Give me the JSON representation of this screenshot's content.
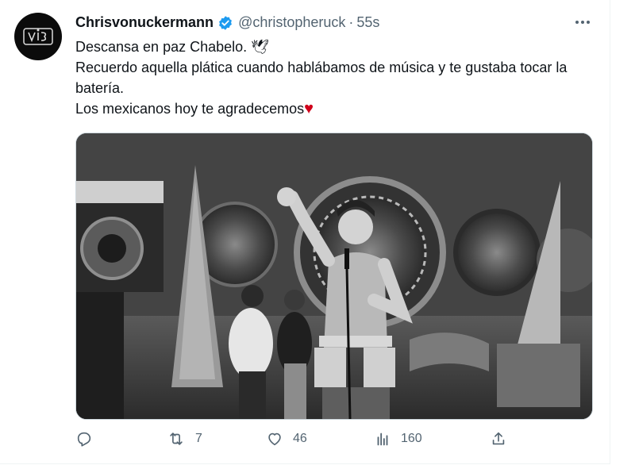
{
  "author": {
    "display_name": "Chrisvonuckermann",
    "handle": "@christopheruck",
    "separator": "·",
    "time": "55s"
  },
  "tweet": {
    "lines": [
      "Descansa en paz Chabelo. 🕊",
      "Recuerdo aquella plática cuando hablábamos de música y te gustaba tocar la batería.",
      "Los mexicanos hoy te agradecemos"
    ],
    "heart_emoji": "♥"
  },
  "media": {
    "icon": "photo-black-and-white",
    "colors": {
      "tint": "#6a6a6a"
    }
  },
  "actions": {
    "reply_count": "",
    "retweet_count": "7",
    "like_count": "46",
    "views_count": "160"
  },
  "colors": {
    "verified": "#1d9bf0",
    "heart": "#e0245e",
    "muted": "#536471",
    "text": "#0f1419"
  }
}
